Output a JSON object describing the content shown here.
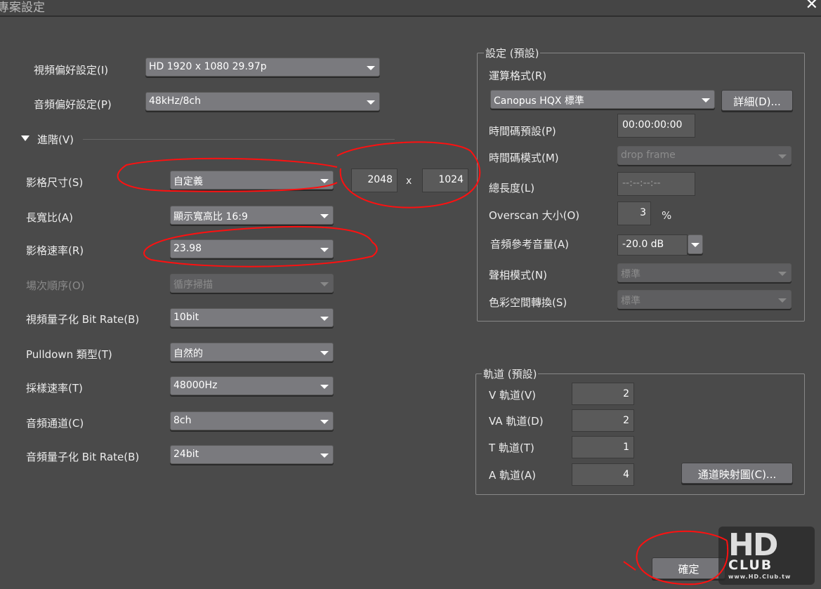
{
  "window": {
    "title": "專案設定",
    "close": "✕"
  },
  "left": {
    "video_pref": {
      "label": "視頻偏好設定(I)",
      "value": "HD 1920 x 1080 29.97p"
    },
    "audio_pref": {
      "label": "音頻偏好設定(P)",
      "value": "48kHz/8ch"
    },
    "advanced": "進階(V)",
    "frame_size": {
      "label": "影格尺寸(S)",
      "value": "自定義",
      "width": "2048",
      "x": "x",
      "height": "1024"
    },
    "aspect": {
      "label": "長寬比(A)",
      "value": "顯示寬高比 16:9"
    },
    "frame_rate": {
      "label": "影格速率(R)",
      "value": "23.98"
    },
    "field_order": {
      "label": "場次順序(O)",
      "value": "循序掃描"
    },
    "video_bit": {
      "label": "視頻量子化 Bit Rate(B)",
      "value": "10bit"
    },
    "pulldown": {
      "label": "Pulldown 類型(T)",
      "value": "自然的"
    },
    "sample_rate": {
      "label": "採樣速率(T)",
      "value": "48000Hz"
    },
    "audio_ch": {
      "label": "音頻通道(C)",
      "value": "8ch"
    },
    "audio_bit": {
      "label": "音頻量子化 Bit Rate(B)",
      "value": "24bit"
    }
  },
  "settings": {
    "title": "設定 (預設)",
    "render_format": {
      "label": "運算格式(R)",
      "value": "Canopus HQX 標準",
      "detail_button": "詳細(D)..."
    },
    "tc_preset": {
      "label": "時間碼預設(P)",
      "value": "00:00:00:00"
    },
    "tc_mode": {
      "label": "時間碼模式(M)",
      "value": "drop frame"
    },
    "total_length": {
      "label": "總長度(L)",
      "value": "--:--:--:--"
    },
    "overscan": {
      "label": "Overscan 大小(O)",
      "value": "3",
      "unit": "%"
    },
    "audio_ref": {
      "label": "音頻參考音量(A)",
      "value": "-20.0 dB"
    },
    "phase_mode": {
      "label": "聲相模式(N)",
      "value": "標準"
    },
    "color_space": {
      "label": "色彩空間轉換(S)",
      "value": "標準"
    }
  },
  "tracks": {
    "title": "軌道 (預設)",
    "v": {
      "label": "V 軌道(V)",
      "value": "2"
    },
    "va": {
      "label": "VA 軌道(D)",
      "value": "2"
    },
    "t": {
      "label": "T 軌道(T)",
      "value": "1"
    },
    "a": {
      "label": "A 軌道(A)",
      "value": "4"
    },
    "channel_map_button": "通道映射圖(C)..."
  },
  "footer": {
    "ok": "確定"
  },
  "watermark": {
    "text": "HD CLUB",
    "url": "www.HD.Club.tw"
  }
}
